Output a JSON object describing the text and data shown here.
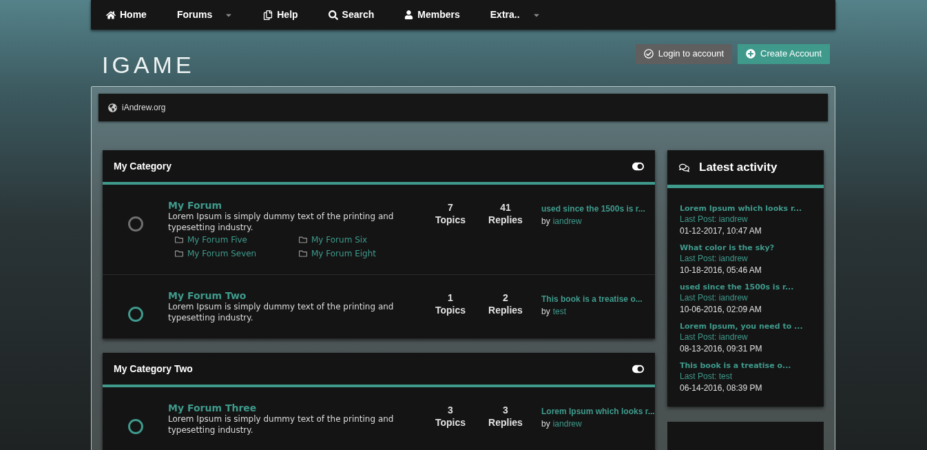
{
  "nav": [
    {
      "label": "Home",
      "kind": "home",
      "dropdown": false
    },
    {
      "label": "Forums",
      "kind": "plain",
      "dropdown": true
    },
    {
      "label": "Help",
      "kind": "help",
      "dropdown": false
    },
    {
      "label": "Search",
      "kind": "search",
      "dropdown": false
    },
    {
      "label": "Members",
      "kind": "members",
      "dropdown": false
    },
    {
      "label": "Extra..",
      "kind": "plain",
      "dropdown": true
    }
  ],
  "logo": "IGAME",
  "account_buttons": [
    {
      "label": "Login to account",
      "kind": "login"
    },
    {
      "label": "Create Account",
      "kind": "create"
    }
  ],
  "breadcrumb": "iAndrew.org",
  "categories": [
    {
      "title": "My Category",
      "expanded": true,
      "forums": [
        {
          "name": "My Forum",
          "has_new": false,
          "description": "Lorem Ipsum is simply dummy text of the printing and typesetting industry.",
          "subforums": [
            "My Forum Five",
            "My Forum Six",
            "My Forum Seven",
            "My Forum Eight"
          ],
          "topics": "7",
          "topics_label": "Topics",
          "replies": "41",
          "replies_label": "Replies",
          "last_post": "used since the 1500s is r...",
          "by": "by",
          "author": "iandrew"
        },
        {
          "name": "My Forum Two",
          "has_new": true,
          "description": "Lorem Ipsum is simply dummy text of the printing and typesetting industry.",
          "topics": "1",
          "topics_label": "Topics",
          "replies": "2",
          "replies_label": "Replies",
          "last_post": "This book is a treatise o...",
          "by": "by",
          "author": "test"
        }
      ]
    },
    {
      "title": "My Category Two",
      "expanded": true,
      "forums": [
        {
          "name": "My Forum Three",
          "has_new": true,
          "description": "Lorem Ipsum is simply dummy text of the printing and typesetting industry.",
          "topics": "3",
          "topics_label": "Topics",
          "replies": "3",
          "replies_label": "Replies",
          "last_post": "Lorem Ipsum which looks r...",
          "by": "by",
          "author": "iandrew"
        }
      ]
    }
  ],
  "latest_activity": {
    "title": "Latest activity",
    "items": [
      {
        "title": "Lorem Ipsum which looks r...",
        "last_post": "Last Post: iandrew",
        "date": "01-12-2017, 10:47 AM"
      },
      {
        "title": "What color is the sky?",
        "last_post": "Last Post: iandrew",
        "date": "10-18-2016, 05:46 AM"
      },
      {
        "title": "used since the 1500s is r...",
        "last_post": "Last Post: iandrew",
        "date": "10-06-2016, 02:09 AM"
      },
      {
        "title": "Lorem Ipsum, you need to ...",
        "last_post": "Last Post: iandrew",
        "date": "08-13-2016, 09:31 PM"
      },
      {
        "title": "This book is a treatise o...",
        "last_post": "Last Post: test",
        "date": "06-14-2016, 08:39 PM"
      }
    ]
  }
}
